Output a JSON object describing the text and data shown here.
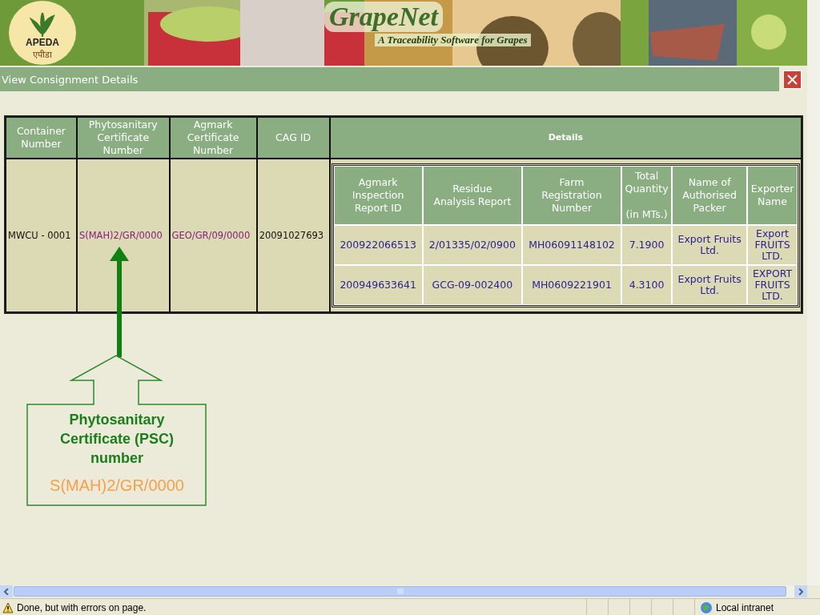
{
  "banner": {
    "logo_name": "APEDA",
    "logo_script": "एपीडा",
    "title": "GrapeNet",
    "subtitle": "A Traceability Software for Grapes"
  },
  "page_title": "View Consignment Details",
  "consignment_table": {
    "columns": [
      "Container\nNumber",
      "Phytosanitary\nCertificate\nNumber",
      "Agmark\nCertificate\nNumber",
      "CAG ID",
      "Details"
    ],
    "row": {
      "container_number": "MWCU - 0001",
      "psc_number": "S(MAH)2/GR/0000",
      "agmark_certificate": "GEO/GR/09/0000",
      "cag_id": "20091027693"
    }
  },
  "details_table": {
    "columns": [
      "Agmark\nInspection\nReport ID",
      "Residue\nAnalysis Report",
      "Farm\nRegistration\nNumber",
      "Total\nQuantity\n\n(in MTs.)",
      "Name of\nAuthorised\nPacker",
      "Exporter\nName"
    ],
    "rows": [
      [
        "200922066513",
        "2/01335/02/0900",
        "MH06091148102",
        "7.1900",
        "Export Fruits\nLtd.",
        "Export\nFRUITS\nLTD."
      ],
      [
        "200949633641",
        "GCG-09-002400",
        "MH0609221901",
        "4.3100",
        "Export Fruits\nLtd.",
        "EXPORT\nFRUITS\nLTD."
      ]
    ]
  },
  "callout": {
    "heading": "Phytosanitary\nCertificate (PSC)\nnumber",
    "value": "S(MAH)2/GR/0000"
  },
  "status_bar": {
    "message": "Done, but with errors on page.",
    "zone": "Local intranet"
  }
}
